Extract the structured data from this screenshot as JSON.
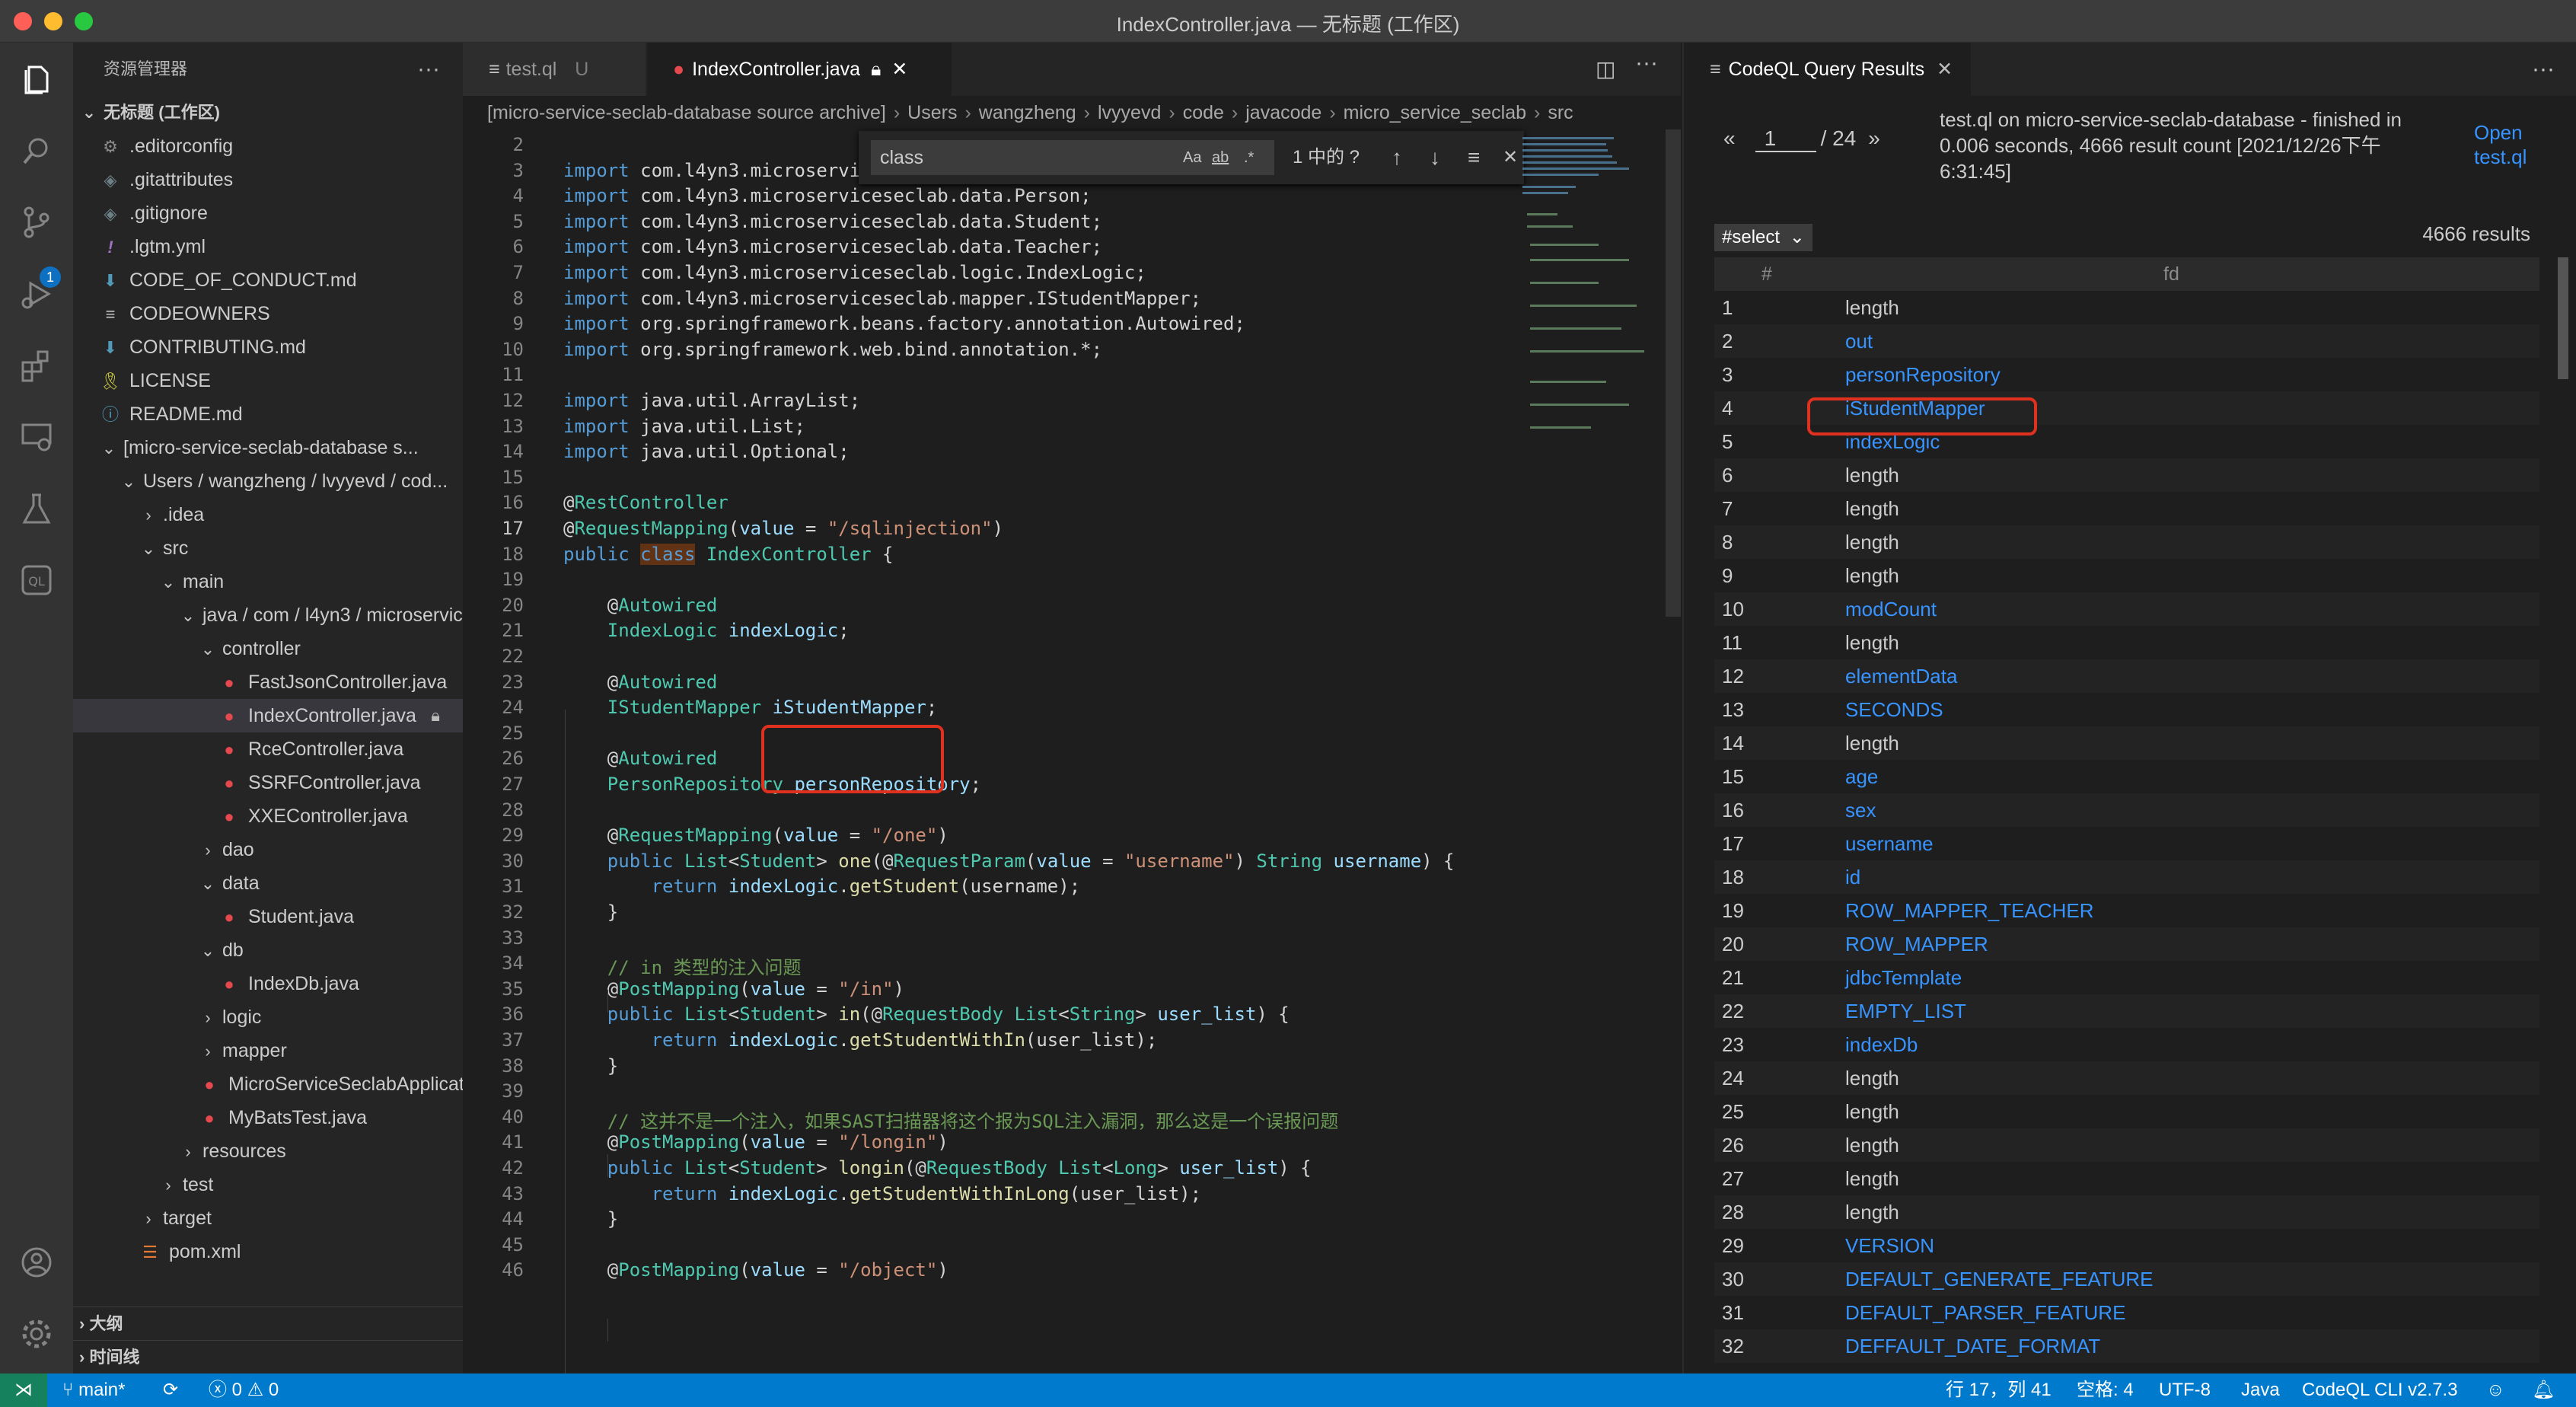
{
  "window": {
    "title": "IndexController.java — 无标题 (工作区)"
  },
  "sidebar": {
    "title": "资源管理器",
    "workspace": "无标题 (工作区)",
    "items": [
      {
        "label": ".editorconfig",
        "icon": "gear",
        "depth": 0
      },
      {
        "label": ".gitattributes",
        "icon": "diamond",
        "depth": 0
      },
      {
        "label": ".gitignore",
        "icon": "diamond",
        "depth": 0
      },
      {
        "label": ".lgtm.yml",
        "icon": "bang",
        "depth": 0
      },
      {
        "label": "CODE_OF_CONDUCT.md",
        "icon": "md",
        "depth": 0
      },
      {
        "label": "CODEOWNERS",
        "icon": "lines",
        "depth": 0
      },
      {
        "label": "CONTRIBUTING.md",
        "icon": "md",
        "depth": 0
      },
      {
        "label": "LICENSE",
        "icon": "license",
        "depth": 0
      },
      {
        "label": "README.md",
        "icon": "info",
        "depth": 0
      },
      {
        "label": "[micro-service-seclab-database s...",
        "chev": "down",
        "depth": 0
      },
      {
        "label": "Users / wangzheng / lvyyevd / cod...",
        "chev": "down",
        "depth": 1
      },
      {
        "label": ".idea",
        "chev": "right",
        "depth": 2
      },
      {
        "label": "src",
        "chev": "down",
        "depth": 2
      },
      {
        "label": "main",
        "chev": "down",
        "depth": 3
      },
      {
        "label": "java / com / l4yn3 / microservic...",
        "chev": "down",
        "depth": 4
      },
      {
        "label": "controller",
        "chev": "down",
        "depth": 5
      },
      {
        "label": "FastJsonController.java",
        "icon": "java",
        "depth": 6
      },
      {
        "label": "IndexController.java",
        "icon": "java",
        "depth": 6,
        "selected": true
      },
      {
        "label": "RceController.java",
        "icon": "java",
        "depth": 6
      },
      {
        "label": "SSRFController.java",
        "icon": "java",
        "depth": 6
      },
      {
        "label": "XXEController.java",
        "icon": "java",
        "depth": 6
      },
      {
        "label": "dao",
        "chev": "right",
        "depth": 5
      },
      {
        "label": "data",
        "chev": "down",
        "depth": 5
      },
      {
        "label": "Student.java",
        "icon": "java",
        "depth": 6
      },
      {
        "label": "db",
        "chev": "down",
        "depth": 5
      },
      {
        "label": "IndexDb.java",
        "icon": "java",
        "depth": 6
      },
      {
        "label": "logic",
        "chev": "right",
        "depth": 5
      },
      {
        "label": "mapper",
        "chev": "right",
        "depth": 5
      },
      {
        "label": "MicroServiceSeclabApplicat...",
        "icon": "java",
        "depth": 5
      },
      {
        "label": "MyBatsTest.java",
        "icon": "java",
        "depth": 5
      },
      {
        "label": "resources",
        "chev": "right",
        "depth": 4
      },
      {
        "label": "test",
        "chev": "right",
        "depth": 3
      },
      {
        "label": "target",
        "chev": "right",
        "depth": 2
      },
      {
        "label": "pom.xml",
        "icon": "rss",
        "depth": 2
      }
    ],
    "outline": "大纲",
    "timeline": "时间线"
  },
  "editor": {
    "tabs": [
      {
        "label": "test.ql",
        "suffix": "U",
        "active": false
      },
      {
        "label": "IndexController.java",
        "active": true
      }
    ],
    "breadcrumb": [
      "[micro-service-seclab-database source archive]",
      "Users",
      "wangzheng",
      "lvyyevd",
      "code",
      "javacode",
      "micro_service_seclab",
      "src"
    ],
    "find": {
      "query": "class",
      "result": "1 中的 ?",
      "case": "Aa",
      "word": "ab",
      "regex": ".*"
    },
    "current_line": 17,
    "lines": [
      {
        "n": 2,
        "html": ""
      },
      {
        "n": 3,
        "html": "<span class='kw'>import</span> com.l4yn3.microserviceseclab.dao.PersonRepository;"
      },
      {
        "n": 4,
        "html": "<span class='kw'>import</span> com.l4yn3.microserviceseclab.data.Person;"
      },
      {
        "n": 5,
        "html": "<span class='kw'>import</span> com.l4yn3.microserviceseclab.data.Student;"
      },
      {
        "n": 6,
        "html": "<span class='kw'>import</span> com.l4yn3.microserviceseclab.data.Teacher;"
      },
      {
        "n": 7,
        "html": "<span class='kw'>import</span> com.l4yn3.microserviceseclab.logic.IndexLogic;"
      },
      {
        "n": 8,
        "html": "<span class='kw'>import</span> com.l4yn3.microserviceseclab.mapper.IStudentMapper;"
      },
      {
        "n": 9,
        "html": "<span class='kw'>import</span> org.springframework.beans.factory.annotation.Autowired;"
      },
      {
        "n": 10,
        "html": "<span class='kw'>import</span> org.springframework.web.bind.annotation.*;"
      },
      {
        "n": 11,
        "html": ""
      },
      {
        "n": 12,
        "html": "<span class='kw'>import</span> java.util.ArrayList;"
      },
      {
        "n": 13,
        "html": "<span class='kw'>import</span> java.util.List;"
      },
      {
        "n": 14,
        "html": "<span class='kw'>import</span> java.util.Optional;"
      },
      {
        "n": 15,
        "html": ""
      },
      {
        "n": 16,
        "html": "@<span class='an'>RestController</span>"
      },
      {
        "n": 17,
        "html": "@<span class='an'>RequestMapping</span>(<span class='va'>value</span> = <span class='st'>\"/sqlinjection\"</span>)"
      },
      {
        "n": 18,
        "html": "<span class='kw'>public</span> <span class='kw hl'>class</span> <span class='ty'>IndexController</span> {"
      },
      {
        "n": 19,
        "html": ""
      },
      {
        "n": 20,
        "html": "    @<span class='an'>Autowired</span>"
      },
      {
        "n": 21,
        "html": "    <span class='ty'>IndexLogic</span> <span class='va'>indexLogic</span>;"
      },
      {
        "n": 22,
        "html": ""
      },
      {
        "n": 23,
        "html": "    @<span class='an'>Autowired</span>"
      },
      {
        "n": 24,
        "html": "    <span class='ty'>IStudentMapper</span> <span class='va'>iStudentMapper</span>;"
      },
      {
        "n": 25,
        "html": ""
      },
      {
        "n": 26,
        "html": "    @<span class='an'>Autowired</span>"
      },
      {
        "n": 27,
        "html": "    <span class='ty'>PersonRepository</span> <span class='va'>personRepository</span>;"
      },
      {
        "n": 28,
        "html": ""
      },
      {
        "n": 29,
        "html": "    @<span class='an'>RequestMapping</span>(<span class='va'>value</span> = <span class='st'>\"/one\"</span>)"
      },
      {
        "n": 30,
        "html": "    <span class='kw'>public</span> <span class='ty'>List</span>&lt;<span class='ty'>Student</span>&gt; <span class='fn'>one</span>(@<span class='an'>RequestParam</span>(<span class='va'>value</span> = <span class='st'>\"username\"</span>) <span class='ty'>String</span> <span class='va'>username</span>) {"
      },
      {
        "n": 31,
        "html": "        <span class='kw'>return</span> <span class='va'>indexLogic</span>.<span class='fn'>getStudent</span>(username);"
      },
      {
        "n": 32,
        "html": "    }"
      },
      {
        "n": 33,
        "html": ""
      },
      {
        "n": 34,
        "html": "    <span class='cm'>// in 类型的注入问题</span>"
      },
      {
        "n": 35,
        "html": "    @<span class='an'>PostMapping</span>(<span class='va'>value</span> = <span class='st'>\"/in\"</span>)"
      },
      {
        "n": 36,
        "html": "    <span class='kw'>public</span> <span class='ty'>List</span>&lt;<span class='ty'>Student</span>&gt; <span class='fn'>in</span>(@<span class='an'>RequestBody</span> <span class='ty'>List</span>&lt;<span class='ty'>String</span>&gt; <span class='va'>user_list</span>) {"
      },
      {
        "n": 37,
        "html": "        <span class='kw'>return</span> <span class='va'>indexLogic</span>.<span class='fn'>getStudentWithIn</span>(user_list);"
      },
      {
        "n": 38,
        "html": "    }"
      },
      {
        "n": 39,
        "html": ""
      },
      {
        "n": 40,
        "html": "    <span class='cm'>// 这并不是一个注入，如果SAST扫描器将这个报为SQL注入漏洞，那么这是一个误报问题</span>"
      },
      {
        "n": 41,
        "html": "    @<span class='an'>PostMapping</span>(<span class='va'>value</span> = <span class='st'>\"/longin\"</span>)"
      },
      {
        "n": 42,
        "html": "    <span class='kw'>public</span> <span class='ty'>List</span>&lt;<span class='ty'>Student</span>&gt; <span class='fn'>longin</span>(@<span class='an'>RequestBody</span> <span class='ty'>List</span>&lt;<span class='ty'>Long</span>&gt; <span class='va'>user_list</span>) {"
      },
      {
        "n": 43,
        "html": "        <span class='kw'>return</span> <span class='va'>indexLogic</span>.<span class='fn'>getStudentWithInLong</span>(user_list);"
      },
      {
        "n": 44,
        "html": "    }"
      },
      {
        "n": 45,
        "html": ""
      },
      {
        "n": 46,
        "html": "    @<span class='an'>PostMapping</span>(<span class='va'>value</span> = <span class='st'>\"/object\"</span>)"
      }
    ]
  },
  "results": {
    "tab": "CodeQL Query Results",
    "page": "1",
    "page_total": "/ 24",
    "info": "test.ql on micro-service-seclab-database - finished in 0.006 seconds, 4666 result count [2021/12/26下午6:31:45]",
    "open_link": "Open test.ql",
    "select": "#select",
    "count": "4666 results",
    "col_index": "#",
    "col_fd": "fd",
    "rows": [
      {
        "n": "1",
        "v": "length",
        "link": false
      },
      {
        "n": "2",
        "v": "out",
        "link": true
      },
      {
        "n": "3",
        "v": "personRepository",
        "link": true
      },
      {
        "n": "4",
        "v": "iStudentMapper",
        "link": true
      },
      {
        "n": "5",
        "v": "indexLogic",
        "link": true
      },
      {
        "n": "6",
        "v": "length",
        "link": false
      },
      {
        "n": "7",
        "v": "length",
        "link": false
      },
      {
        "n": "8",
        "v": "length",
        "link": false
      },
      {
        "n": "9",
        "v": "length",
        "link": false
      },
      {
        "n": "10",
        "v": "modCount",
        "link": true
      },
      {
        "n": "11",
        "v": "length",
        "link": false
      },
      {
        "n": "12",
        "v": "elementData",
        "link": true
      },
      {
        "n": "13",
        "v": "SECONDS",
        "link": true
      },
      {
        "n": "14",
        "v": "length",
        "link": false
      },
      {
        "n": "15",
        "v": "age",
        "link": true
      },
      {
        "n": "16",
        "v": "sex",
        "link": true
      },
      {
        "n": "17",
        "v": "username",
        "link": true
      },
      {
        "n": "18",
        "v": "id",
        "link": true
      },
      {
        "n": "19",
        "v": "ROW_MAPPER_TEACHER",
        "link": true
      },
      {
        "n": "20",
        "v": "ROW_MAPPER",
        "link": true
      },
      {
        "n": "21",
        "v": "jdbcTemplate",
        "link": true
      },
      {
        "n": "22",
        "v": "EMPTY_LIST",
        "link": true
      },
      {
        "n": "23",
        "v": "indexDb",
        "link": true
      },
      {
        "n": "24",
        "v": "length",
        "link": false
      },
      {
        "n": "25",
        "v": "length",
        "link": false
      },
      {
        "n": "26",
        "v": "length",
        "link": false
      },
      {
        "n": "27",
        "v": "length",
        "link": false
      },
      {
        "n": "28",
        "v": "length",
        "link": false
      },
      {
        "n": "29",
        "v": "VERSION",
        "link": true
      },
      {
        "n": "30",
        "v": "DEFAULT_GENERATE_FEATURE",
        "link": true
      },
      {
        "n": "31",
        "v": "DEFAULT_PARSER_FEATURE",
        "link": true
      },
      {
        "n": "32",
        "v": "DEFFAULT_DATE_FORMAT",
        "link": true
      }
    ]
  },
  "statusbar": {
    "branch": "main*",
    "errors": "0",
    "warnings": "0",
    "position": "行 17，列 41",
    "spaces": "空格: 4",
    "encoding": "UTF-8",
    "language": "Java",
    "cli": "CodeQL CLI v2.7.3"
  },
  "colors": {
    "accent": "#007acc",
    "highlight_box": "#e0301e",
    "link": "#3794ff"
  }
}
